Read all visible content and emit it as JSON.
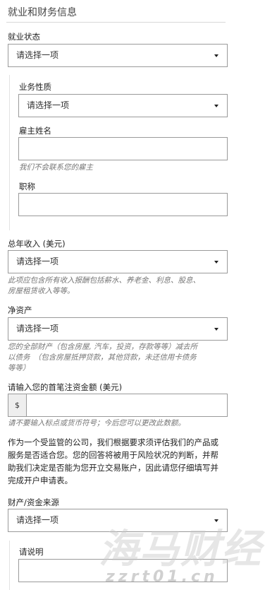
{
  "section": {
    "title": "就业和财务信息"
  },
  "employment": {
    "label": "就业状态",
    "select_value": "请选择一项",
    "business_nature": {
      "label": "业务性质",
      "select_value": "请选择一项"
    },
    "employer_name": {
      "label": "雇主姓名",
      "value": "",
      "hint": "我们不会联系您的雇主"
    },
    "job_title": {
      "label": "职称",
      "value": ""
    }
  },
  "annual_income": {
    "label": "总年收入 (美元)",
    "select_value": "请选择一项",
    "hint_line1": "此项应包含所有收入报酬包括薪水、养老金、利息、股息、",
    "hint_line2": "房屋租赁收入等等。"
  },
  "net_worth": {
    "label": "净资产",
    "select_value": "请选择一项",
    "hint_line1": "您的全部财产（包含房屋, 汽车，投资，存款等等）减去所",
    "hint_line2": "以债务　（包含房屋抵押贷款，其他贷款，未还信用卡债务",
    "hint_line3": "等等）"
  },
  "initial_deposit": {
    "label": "请输入您的首笔注资金额 (美元)",
    "currency_symbol": "$",
    "value": "",
    "hint": "请不要输入标点或货币符号；今后您可以更改此数额。"
  },
  "disclaimer": {
    "line1": "作为一个受监管的公司，我们根据要求须评估我们的产品或",
    "line2": "服务是否适合您。您的回答将被用于风险状况的判断，并帮",
    "line3": "助我们决定是否能为您开立交易账户，因此请您仔细填写并",
    "line4": "完成开户申请表。"
  },
  "funds_source": {
    "label": "财产/资金来源",
    "select_value": "请选择一项",
    "explain": {
      "label": "请说明",
      "value": ""
    }
  },
  "watermark": {
    "main": "海马财经",
    "sub": "zzrt01.cn"
  }
}
